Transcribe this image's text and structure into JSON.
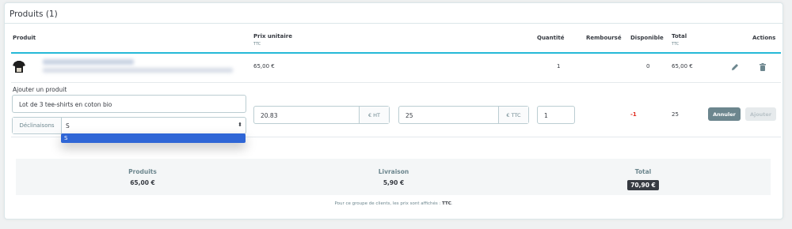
{
  "panel": {
    "title": "Produits (1)"
  },
  "table": {
    "headers": {
      "product": "Produit",
      "unit_price": "Prix unitaire",
      "unit_price_sub": "TTC",
      "quantity": "Quantité",
      "refunded": "Remboursé",
      "available": "Disponible",
      "total": "Total",
      "total_sub": "TTC",
      "actions": "Actions"
    },
    "rows": [
      {
        "unit_price": "65,00 €",
        "quantity": "1",
        "available": "0",
        "total": "65,00 €"
      }
    ]
  },
  "add_product": {
    "label": "Ajouter un produit",
    "search_value": "Lot de 3 tee-shirts en coton bio",
    "combinations_label": "Déclinaisons",
    "combination_value": "S",
    "dropdown_options": [
      "S"
    ],
    "price_ht": "20.83",
    "price_ht_addon": "€ HT",
    "price_ttc": "25",
    "price_ttc_addon": "€ TTC",
    "quantity": "1",
    "available": "-1",
    "total": "25",
    "cancel_label": "Annuler",
    "add_label": "Ajouter"
  },
  "totals": {
    "products_label": "Produits",
    "products_value": "65,00 €",
    "shipping_label": "Livraison",
    "shipping_value": "5,90 €",
    "total_label": "Total",
    "total_value": "70,90 €"
  },
  "footnote": {
    "text": "Pour ce groupe de clients, les prix sont affichés :",
    "tax": "TTC"
  },
  "colors": {
    "accent": "#25b9d7",
    "selected_option": "#2f66d6",
    "negative": "#e0291c",
    "cancel_button": "#6c868e"
  }
}
